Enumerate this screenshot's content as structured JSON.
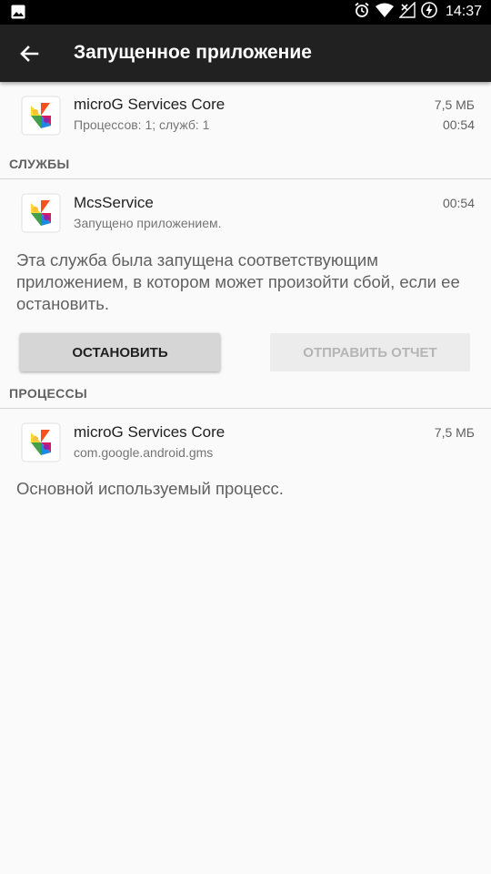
{
  "status_bar": {
    "time": "14:37",
    "icons": [
      "image-icon",
      "alarm-icon",
      "wifi-icon",
      "no-signal-icon",
      "battery-charging-icon"
    ]
  },
  "toolbar": {
    "back_icon": "arrow-back-icon",
    "title": "Запущенное приложение"
  },
  "app": {
    "name": "microG Services Core",
    "summary": "Процессов: 1; служб: 1",
    "size": "7,5 МБ",
    "time": "00:54"
  },
  "services": {
    "header": "СЛУЖБЫ",
    "items": [
      {
        "name": "McsService",
        "status": "Запущено приложением.",
        "time": "00:54",
        "description": "Эта служба была запущена соответствующим приложением, в котором может произойти сбой, если ее остановить."
      }
    ],
    "stop_label": "ОСТАНОВИТЬ",
    "report_label": "ОТПРАВИТЬ ОТЧЕТ"
  },
  "processes": {
    "header": "ПРОЦЕССЫ",
    "items": [
      {
        "name": "microG Services Core",
        "package": "com.google.android.gms",
        "size": "7,5 МБ",
        "description": "Основной используемый процесс."
      }
    ]
  },
  "colors": {
    "toolbar": "#212121",
    "status_bar": "#000000",
    "background": "#fafafa"
  }
}
